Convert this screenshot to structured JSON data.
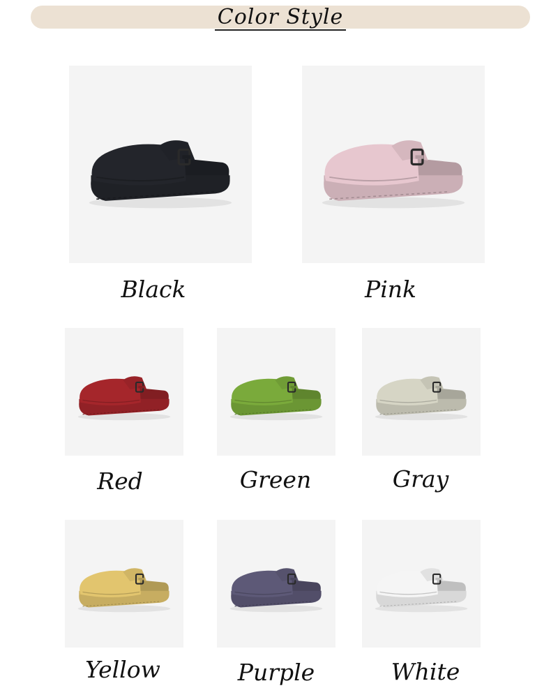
{
  "title": "Color Style",
  "colors": [
    {
      "label": "Black",
      "fill": "#23252b"
    },
    {
      "label": "Pink",
      "fill": "#e7c7cf"
    },
    {
      "label": "Red",
      "fill": "#a5262b"
    },
    {
      "label": "Green",
      "fill": "#7aaa3b"
    },
    {
      "label": "Gray",
      "fill": "#d6d5c5"
    },
    {
      "label": "Yellow",
      "fill": "#e2c56e"
    },
    {
      "label": "Purple",
      "fill": "#5d5977"
    },
    {
      "label": "White",
      "fill": "#f5f5f5"
    }
  ]
}
